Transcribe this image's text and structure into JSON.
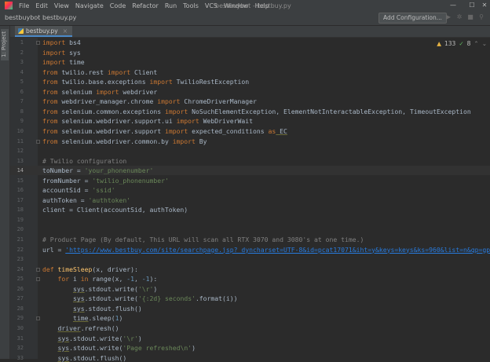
{
  "window": {
    "title": "bestbuybot - bestbuy.py"
  },
  "menu": [
    "File",
    "Edit",
    "View",
    "Navigate",
    "Code",
    "Refactor",
    "Run",
    "Tools",
    "VCS",
    "Window",
    "Help"
  ],
  "window_controls": {
    "minimize": "—",
    "maximize": "☐",
    "close": "✕"
  },
  "nav": {
    "project": "bestbuybot",
    "file": "bestbuy.py",
    "add_config": "Add Configuration..."
  },
  "sidebar": {
    "project_tab": "1: Project"
  },
  "tab": {
    "name": "bestbuy.py"
  },
  "inspections": {
    "warnings": "133",
    "checks": "8"
  },
  "current_line": 14,
  "lines": [
    [
      {
        "k": "kw",
        "t": "import"
      },
      {
        "t": " bs4"
      }
    ],
    [
      {
        "k": "kw",
        "t": "import"
      },
      {
        "t": " sys"
      }
    ],
    [
      {
        "k": "kw",
        "t": "import"
      },
      {
        "t": " time"
      }
    ],
    [
      {
        "k": "kw",
        "t": "from"
      },
      {
        "t": " twilio.rest "
      },
      {
        "k": "kw",
        "t": "import"
      },
      {
        "t": " Client"
      }
    ],
    [
      {
        "k": "kw",
        "t": "from"
      },
      {
        "t": " twilio.base.exceptions "
      },
      {
        "k": "kw",
        "t": "import"
      },
      {
        "t": " TwilioRestException"
      }
    ],
    [
      {
        "k": "kw",
        "t": "from"
      },
      {
        "t": " selenium "
      },
      {
        "k": "kw",
        "t": "import"
      },
      {
        "t": " webdriver"
      }
    ],
    [
      {
        "k": "kw",
        "t": "from"
      },
      {
        "t": " webdriver_manager.chrome "
      },
      {
        "k": "kw",
        "t": "import"
      },
      {
        "t": " ChromeDriverManager"
      }
    ],
    [
      {
        "k": "kw",
        "t": "from"
      },
      {
        "t": " selenium.common.exceptions "
      },
      {
        "k": "kw",
        "t": "import"
      },
      {
        "t": " NoSuchElementException, ElementNotInteractableException, TimeoutException"
      }
    ],
    [
      {
        "k": "kw",
        "t": "from"
      },
      {
        "t": " selenium.webdriver.support.ui "
      },
      {
        "k": "kw",
        "t": "import"
      },
      {
        "t": " WebDriverWait"
      }
    ],
    [
      {
        "k": "kw",
        "t": "from"
      },
      {
        "t": " selenium.webdriver.support "
      },
      {
        "k": "kw",
        "t": "import"
      },
      {
        "t": " expected_conditions "
      },
      {
        "k": "kw",
        "t": "as"
      },
      {
        "k": "ul",
        "t": " EC"
      }
    ],
    [
      {
        "k": "kw",
        "t": "from"
      },
      {
        "t": " selenium.webdriver.common.by "
      },
      {
        "k": "kw",
        "t": "import"
      },
      {
        "t": " By"
      }
    ],
    [],
    [
      {
        "k": "cm",
        "t": "# Twilio configuration"
      }
    ],
    [
      {
        "t": "toNumber = "
      },
      {
        "k": "str",
        "t": "'your_phonenumber'"
      }
    ],
    [
      {
        "t": "fromNumber = "
      },
      {
        "k": "str",
        "t": "'twilio_phonenumber'"
      }
    ],
    [
      {
        "t": "accountSid = "
      },
      {
        "k": "str",
        "t": "'ssid'"
      }
    ],
    [
      {
        "t": "authToken = "
      },
      {
        "k": "str",
        "t": "'authtoken'"
      }
    ],
    [
      {
        "t": "client = Client(accountSid, authToken)"
      }
    ],
    [],
    [],
    [
      {
        "k": "cm",
        "t": "# Product Page (By default, This URL will scan all RTX 3070 and 3080's at one time.)"
      }
    ],
    [
      {
        "t": "url = "
      },
      {
        "k": "link",
        "t": "'https://www.bestbuy.com/site/searchpage.jsp?_dyncharset=UTF-8&id=pcat17071&iht=y&keys=keys&ks=960&list=n&qp=gpusv"
      }
    ],
    [],
    [
      {
        "k": "kw",
        "t": "def "
      },
      {
        "k": "fn",
        "t": "timeSleep"
      },
      {
        "t": "(x, driver):"
      }
    ],
    [
      {
        "t": "    "
      },
      {
        "k": "kw",
        "t": "for"
      },
      {
        "t": " i "
      },
      {
        "k": "kw",
        "t": "in"
      },
      {
        "t": " range(x, "
      },
      {
        "k": "num",
        "t": "-1"
      },
      {
        "t": ", "
      },
      {
        "k": "num",
        "t": "-1"
      },
      {
        "t": "):"
      }
    ],
    [
      {
        "t": "        "
      },
      {
        "k": "ul",
        "t": "sys"
      },
      {
        "t": ".stdout.write("
      },
      {
        "k": "str",
        "t": "'\\r'"
      },
      {
        "t": ")"
      }
    ],
    [
      {
        "t": "        "
      },
      {
        "k": "ul",
        "t": "sys"
      },
      {
        "t": ".stdout.write("
      },
      {
        "k": "str",
        "t": "'{:2d} seconds'"
      },
      {
        "t": ".format(i))"
      }
    ],
    [
      {
        "t": "        "
      },
      {
        "k": "ul",
        "t": "sys"
      },
      {
        "t": ".stdout.flush()"
      }
    ],
    [
      {
        "t": "        "
      },
      {
        "k": "ul",
        "t": "time"
      },
      {
        "t": ".sleep("
      },
      {
        "k": "num",
        "t": "1"
      },
      {
        "t": ")"
      }
    ],
    [
      {
        "t": "    "
      },
      {
        "k": "ul",
        "t": "driver"
      },
      {
        "t": ".refresh()"
      }
    ],
    [
      {
        "t": "    "
      },
      {
        "k": "ul",
        "t": "sys"
      },
      {
        "t": ".stdout.write("
      },
      {
        "k": "str",
        "t": "'\\r'"
      },
      {
        "t": ")"
      }
    ],
    [
      {
        "t": "    "
      },
      {
        "k": "ul",
        "t": "sys"
      },
      {
        "t": ".stdout.write("
      },
      {
        "k": "str",
        "t": "'Page refreshed\\n'"
      },
      {
        "t": ")"
      }
    ],
    [
      {
        "t": "    "
      },
      {
        "k": "ul",
        "t": "sys"
      },
      {
        "t": ".stdout.flush()"
      }
    ]
  ],
  "fold_lines": [
    1,
    11,
    24,
    25,
    29
  ],
  "colors": {
    "keyword": "#cc7832",
    "string": "#6a8759",
    "comment": "#808080",
    "number": "#6897bb",
    "function": "#ffc66d",
    "text": "#a9b7c6",
    "background": "#2b2b2b"
  }
}
